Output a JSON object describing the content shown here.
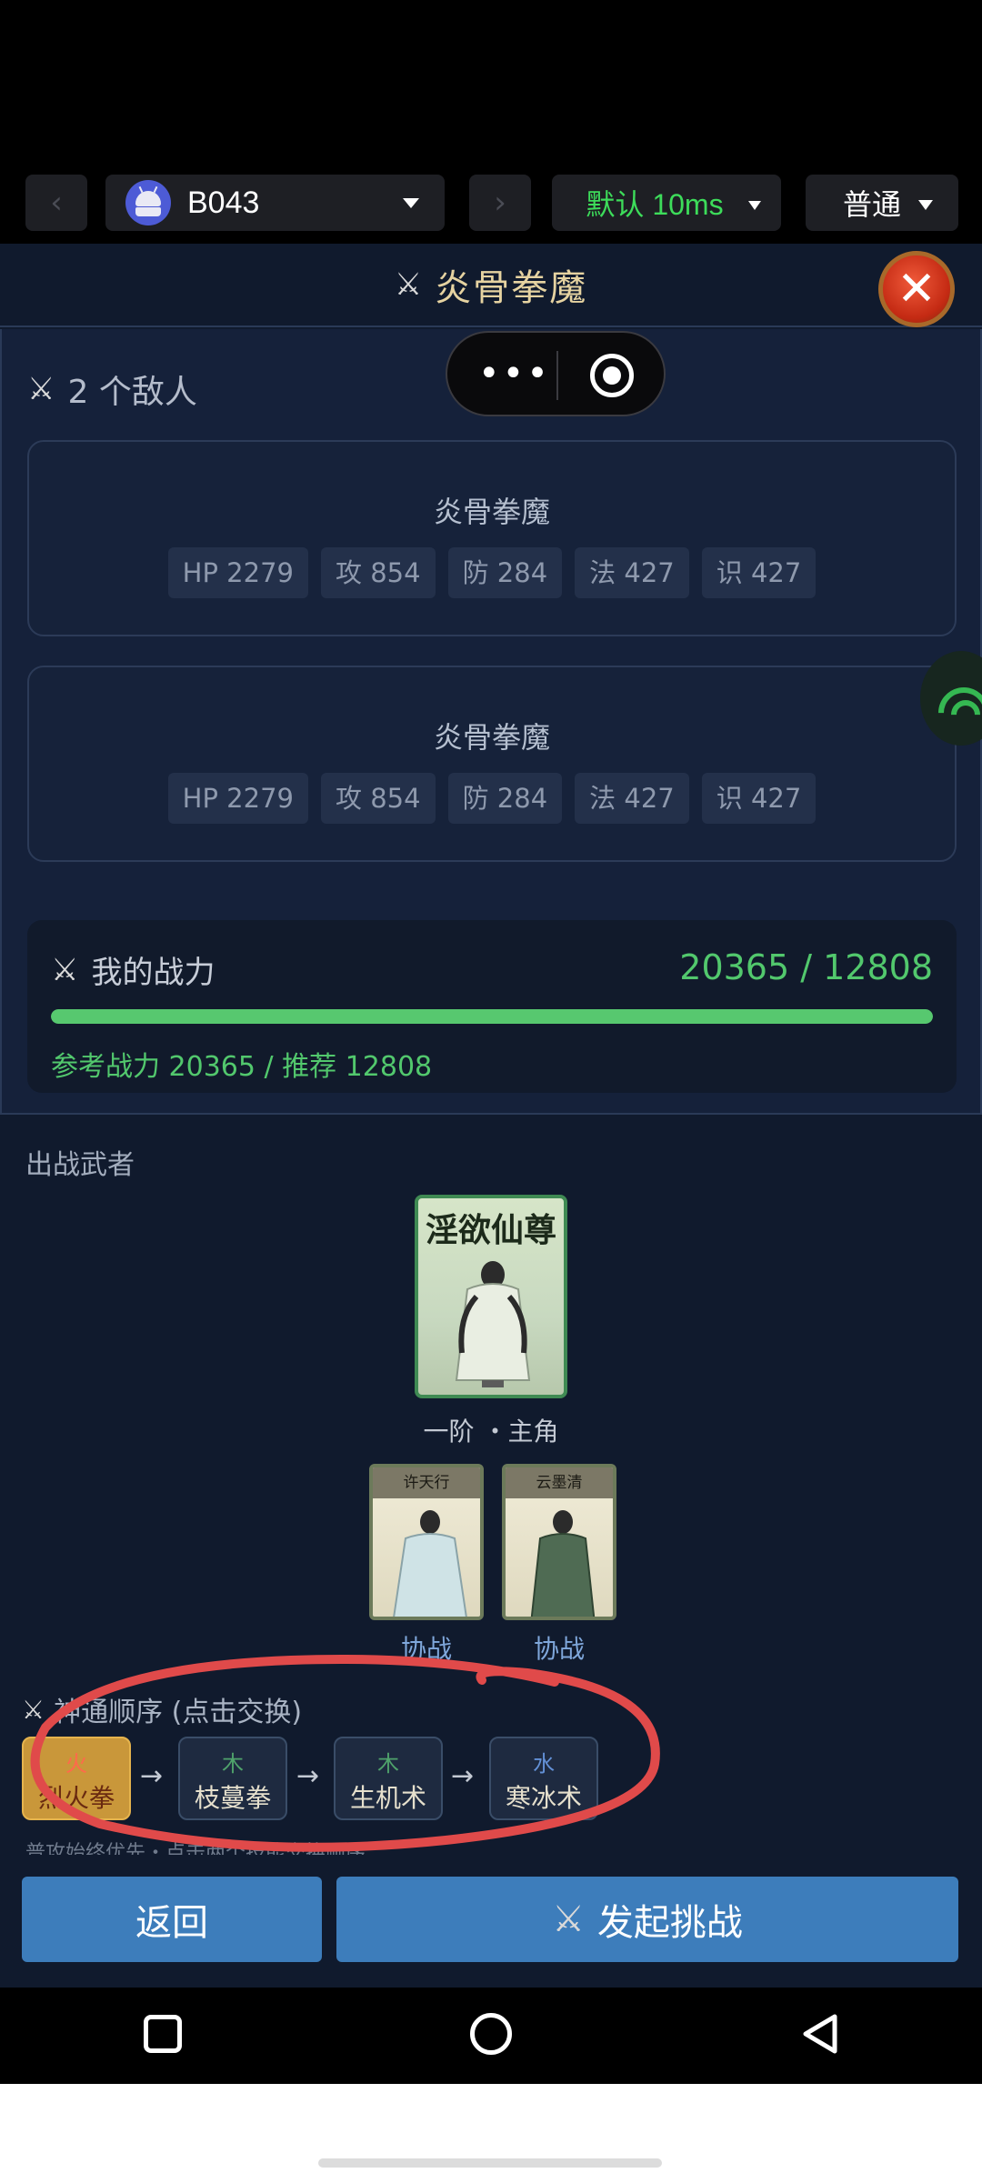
{
  "toolbar": {
    "prev_icon": "chevron-left-icon",
    "next_icon": "chevron-right-icon",
    "device_name": "B043",
    "device_icon": "android-icon",
    "latency": "默认 10ms",
    "mode": "普通"
  },
  "dialog": {
    "title": "炎骨拳魔",
    "close_icon": "close-icon"
  },
  "enemies": {
    "count_label": "2 个敌人",
    "cards": [
      {
        "name": "炎骨拳魔",
        "stats": [
          "HP 2279",
          "攻 854",
          "防 284",
          "法 427",
          "识 427"
        ]
      },
      {
        "name": "炎骨拳魔",
        "stats": [
          "HP 2279",
          "攻 854",
          "防 284",
          "法 427",
          "识 427"
        ]
      }
    ]
  },
  "power": {
    "label": "我的战力",
    "value": "20365 / 12808",
    "bar_fill_percent": 100,
    "sub": "参考战力 20365 / 推荐 12808"
  },
  "lineup": {
    "section_label": "出战武者",
    "hero_name": "淫欲仙尊",
    "hero_caption": "一阶 ・主角",
    "allies": [
      {
        "top": "许天行",
        "label": "协战"
      },
      {
        "top": "云墨清",
        "label": "协战"
      }
    ]
  },
  "skills": {
    "title": "神通顺序 (点击交换)",
    "items": [
      {
        "element": "火",
        "name": "烈火拳"
      },
      {
        "element": "木",
        "name": "枝蔓拳"
      },
      {
        "element": "木",
        "name": "生机术"
      },
      {
        "element": "水",
        "name": "寒冰术"
      }
    ],
    "arrow": "→",
    "note": "普攻始终优先・点击两个技能交换顺序"
  },
  "buttons": {
    "back": "返回",
    "challenge": "发起挑战"
  },
  "colors": {
    "accent_green": "#52c86d",
    "button_blue": "#3d7dbb",
    "panel_bg": "#15213a",
    "annotation_red": "#e04a4a"
  }
}
